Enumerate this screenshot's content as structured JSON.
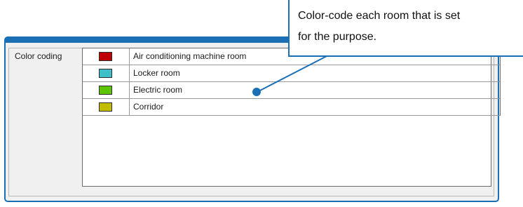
{
  "color_coding": {
    "label": "Color coding",
    "items": [
      {
        "color": "#c00000",
        "label": "Air conditioning machine room"
      },
      {
        "color": "#3fbfc8",
        "label": "Locker room"
      },
      {
        "color": "#5cc400",
        "label": "Electric room"
      },
      {
        "color": "#c3bd00",
        "label": "Corridor"
      }
    ]
  },
  "callout": {
    "line1": "Color-code each room that is set",
    "line2": "for the purpose."
  },
  "colors": {
    "accent": "#1a6fb5"
  }
}
